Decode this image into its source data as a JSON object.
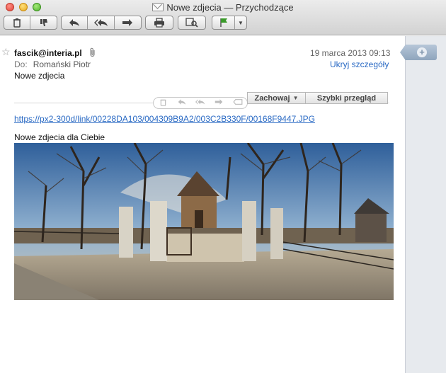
{
  "window": {
    "title": "Nowe zdjecia — Przychodzące"
  },
  "toolbar": {
    "icons": [
      "trash-icon",
      "junk-thumbs-down-icon",
      "reply-icon",
      "reply-all-icon",
      "forward-icon",
      "print-icon",
      "show-related-icon",
      "flag-icon",
      "chevron-down-icon"
    ]
  },
  "message": {
    "from": "fascik@interia.pl",
    "date": "19 marca 2013 09:13",
    "to_label": "Do:",
    "to_name": "Romański Piotr",
    "hide_details": "Ukryj szczegóły",
    "subject": "Nowe zdjecia",
    "save_label": "Zachowaj",
    "quick_look_label": "Szybki przegląd",
    "attachment_link": "https://px2-300d/link/00228DA103/004309B9A2/003C2B330F/00168F9447.JPG",
    "body_text": "Nowe zdjecia dla Ciebie"
  },
  "colors": {
    "link": "#2a6ac4",
    "sidebar": "#e7eaee",
    "note_tab": "#8fa5bd"
  }
}
